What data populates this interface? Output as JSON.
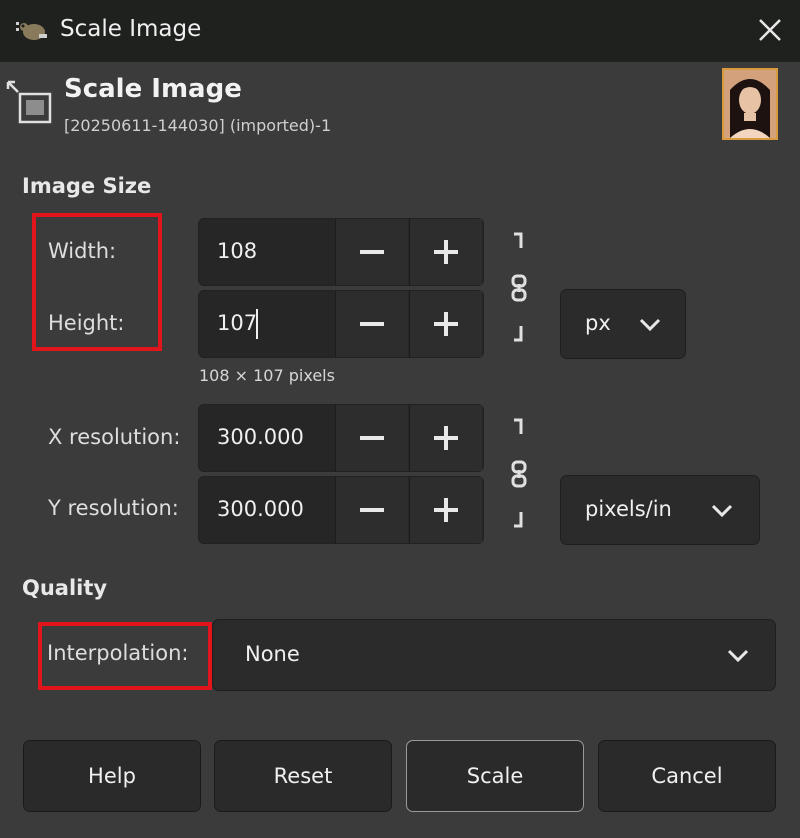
{
  "window": {
    "title": "Scale Image"
  },
  "header": {
    "title": "Scale Image",
    "subtitle": "[20250611-144030] (imported)-1"
  },
  "image_size": {
    "section_label": "Image Size",
    "width_label": "Width:",
    "width_value": "108",
    "height_label": "Height:",
    "height_value": "107",
    "unit": "px",
    "pixel_info": "108 × 107 pixels",
    "xres_label": "X resolution:",
    "xres_value": "300.000",
    "yres_label": "Y resolution:",
    "yres_value": "300.000",
    "res_unit": "pixels/in"
  },
  "quality": {
    "section_label": "Quality",
    "interpolation_label": "Interpolation:",
    "interpolation_value": "None"
  },
  "buttons": {
    "help": "Help",
    "reset": "Reset",
    "scale": "Scale",
    "cancel": "Cancel"
  },
  "colors": {
    "background": "#3b3b3b",
    "titlebar": "#1f211f",
    "field": "#262626",
    "highlight_box": "#e0161c"
  },
  "icons": [
    "gimp-icon",
    "close-icon",
    "scale-image-icon",
    "minus-icon",
    "plus-icon",
    "chain-link-icon",
    "chevron-down-icon"
  ]
}
